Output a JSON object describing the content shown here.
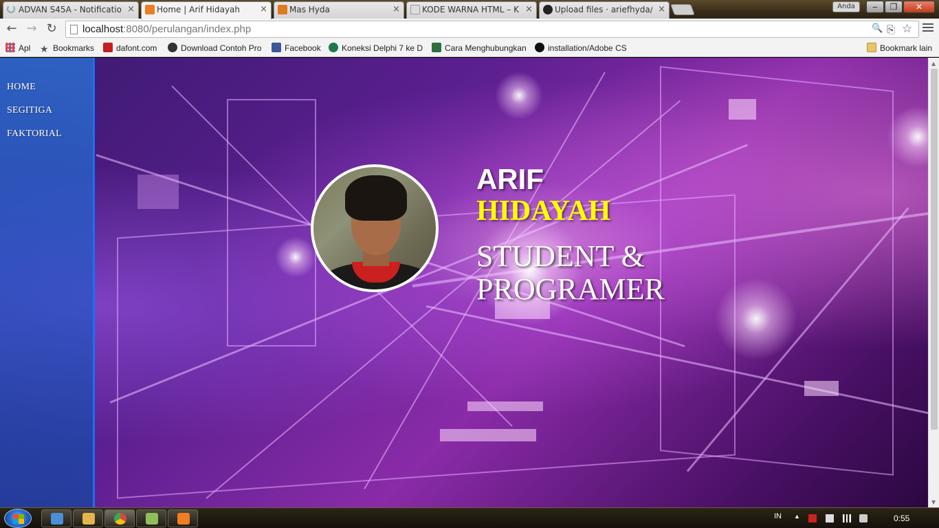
{
  "browser": {
    "tabs": [
      {
        "label": "ADVAN S45A - Notificatio",
        "active": false,
        "icon": "loading-icon"
      },
      {
        "label": "Home | Arif Hidayah",
        "active": true,
        "icon": "xampp-icon"
      },
      {
        "label": "Mas Hyda",
        "active": false,
        "icon": "blogger-icon"
      },
      {
        "label": "KODE WARNA HTML – KL",
        "active": false,
        "icon": "page-icon"
      },
      {
        "label": "Upload files · ariefhyda/Pe",
        "active": false,
        "icon": "github-icon"
      }
    ],
    "close_glyph": "×",
    "user_badge": "Anda",
    "window_buttons": {
      "minimize": "‒",
      "maximize": "❐",
      "close": "✕"
    },
    "url_host": "localhost",
    "url_path": ":8080/perulangan/index.php",
    "nav": {
      "back": "←",
      "forward": "→",
      "reload": "↻"
    },
    "omni_icons": {
      "search": "🔍",
      "translate": "⎘",
      "star": "☆"
    }
  },
  "bookmarks": {
    "items": [
      {
        "label": "Apl",
        "icon": "apps-icon",
        "color": "#e8453c"
      },
      {
        "label": "Bookmarks",
        "icon": "star-icon",
        "color": "#555555"
      },
      {
        "label": "dafont.com",
        "icon": "dafont-icon",
        "color": "#c41e1e"
      },
      {
        "label": "Download Contoh Pro",
        "icon": "globe-icon",
        "color": "#333333"
      },
      {
        "label": "Facebook",
        "icon": "facebook-icon",
        "color": "#3b5998"
      },
      {
        "label": "Koneksi Delphi 7 ke D",
        "icon": "page-icon",
        "color": "#1f7a4a"
      },
      {
        "label": "Cara Menghubungkan",
        "icon": "page-icon",
        "color": "#2f6f3f"
      },
      {
        "label": "installation/Adobe CS",
        "icon": "github-icon",
        "color": "#111111"
      }
    ],
    "other": "Bookmark lain"
  },
  "sidebar": {
    "items": [
      {
        "label": "HOME"
      },
      {
        "label": "SEGITIGA"
      },
      {
        "label": "FAKTORIAL"
      }
    ]
  },
  "profile": {
    "first_name": "ARIF",
    "last_name": "HIDAYAH",
    "role_line1": "STUDENT &",
    "role_line2": "PROGRAMER"
  },
  "taskbar": {
    "apps": [
      {
        "name": "keyboard",
        "color": "#4a8fd8"
      },
      {
        "name": "explorer",
        "color": "#e3b54a"
      },
      {
        "name": "chrome",
        "color": "#d94a3a"
      },
      {
        "name": "notepad",
        "color": "#8fbf5a"
      },
      {
        "name": "xampp",
        "color": "#f07d22"
      }
    ],
    "language": "IN",
    "clock": "0:55"
  },
  "colors": {
    "accent_yellow": "#ffff00",
    "sidebar_border": "#1e6ff0"
  }
}
